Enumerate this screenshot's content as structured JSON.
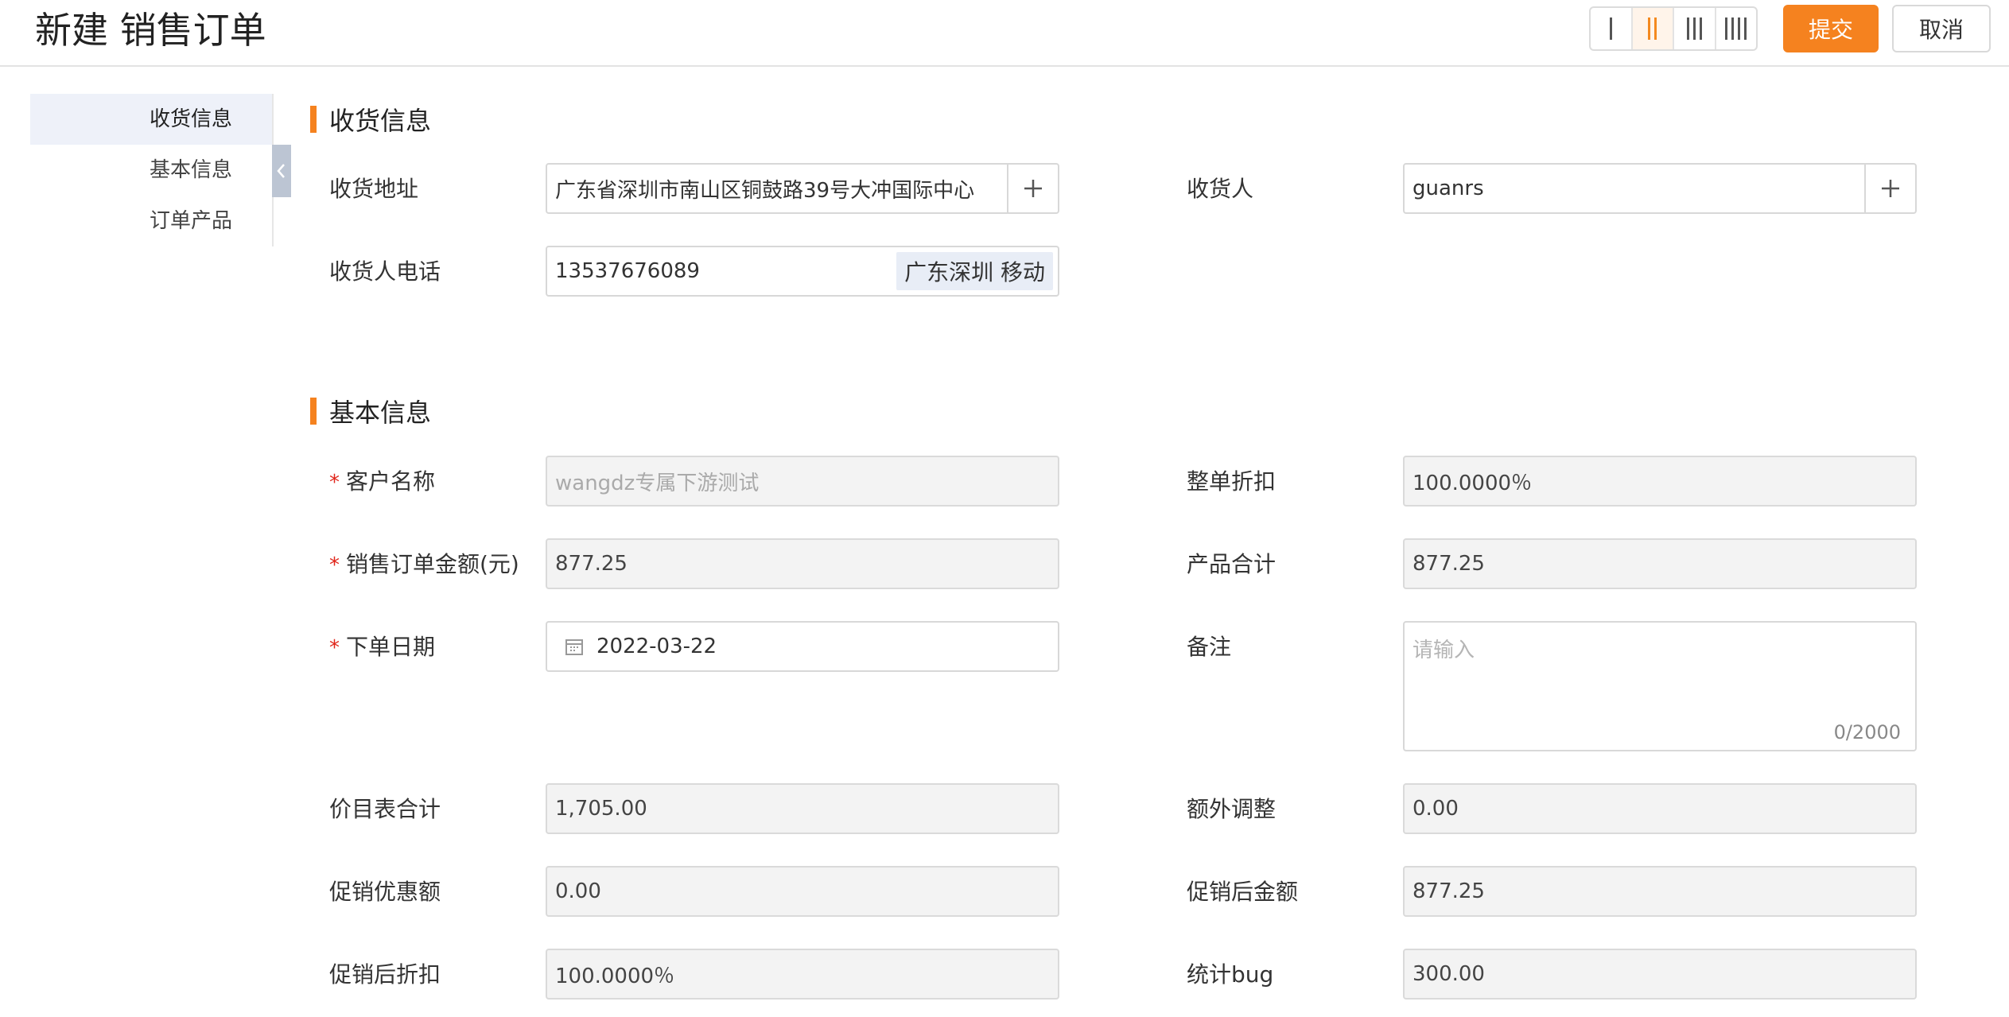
{
  "header": {
    "title": "新建 销售订单",
    "submit_label": "提交",
    "cancel_label": "取消",
    "layout_options": [
      "1 column",
      "2 columns",
      "3 columns",
      "4 columns"
    ],
    "layout_selected": "2 columns",
    "accent_color": "#f5821f"
  },
  "sidenav": {
    "items": [
      {
        "label": "收货信息",
        "active": true
      },
      {
        "label": "基本信息",
        "active": false
      },
      {
        "label": "订单产品",
        "active": false
      }
    ],
    "collapse_icon": "chevron-left-icon"
  },
  "shipping": {
    "section_title": "收货信息",
    "address_label": "收货地址",
    "address_value": "广东省深圳市南山区铜鼓路39号大冲国际中心",
    "receiver_label": "收货人",
    "receiver_value": "guanrs",
    "phone_label": "收货人电话",
    "phone_value": "13537676089",
    "phone_tag": "广东深圳 移动"
  },
  "basic": {
    "section_title": "基本信息",
    "customer_label": "客户名称",
    "customer_value": "wangdz专属下游测试",
    "discount_label": "整单折扣",
    "discount_value": "100.0000％",
    "order_amount_label": "销售订单金额(元)",
    "order_amount_value": "877.25",
    "product_total_label": "产品合计",
    "product_total_value": "877.25",
    "order_date_label": "下单日期",
    "order_date_value": "2022-03-22",
    "remark_label": "备注",
    "remark_placeholder": "请输入",
    "remark_count": "0/2000",
    "pricelist_total_label": "价目表合计",
    "pricelist_total_value": "1,705.00",
    "extra_adjust_label": "额外调整",
    "extra_adjust_value": "0.00",
    "promo_discount_label": "促销优惠额",
    "promo_discount_value": "0.00",
    "promo_amount_label": "促销后金额",
    "promo_amount_value": "877.25",
    "promo_rate_label": "促销后折扣",
    "promo_rate_value": "100.0000％",
    "stat_bug_label": "统计bug",
    "stat_bug_value": "300.00",
    "required_mark": "*"
  }
}
